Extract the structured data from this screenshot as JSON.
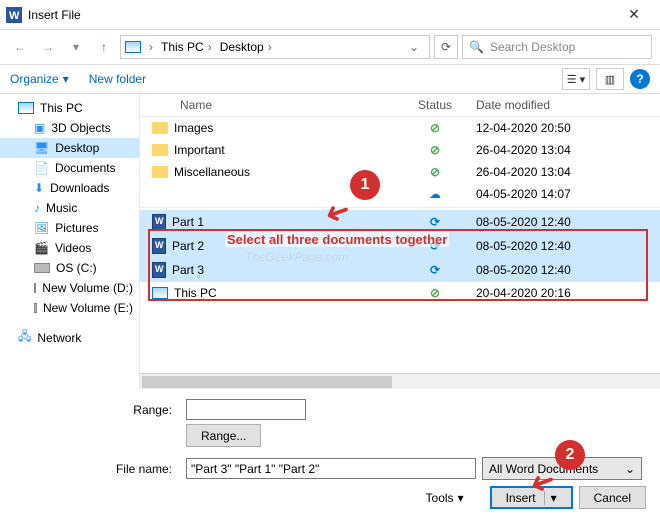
{
  "title": "Insert File",
  "breadcrumb": {
    "root": "",
    "pc": "This PC",
    "loc": "Desktop"
  },
  "search": {
    "placeholder": "Search Desktop"
  },
  "toolbar": {
    "organize": "Organize",
    "newfolder": "New folder"
  },
  "columns": {
    "name": "Name",
    "status": "Status",
    "date": "Date modified"
  },
  "sidebar": {
    "thispc": "This PC",
    "objects3d": "3D Objects",
    "desktop": "Desktop",
    "documents": "Documents",
    "downloads": "Downloads",
    "music": "Music",
    "pictures": "Pictures",
    "videos": "Videos",
    "osc": "OS (C:)",
    "vold": "New Volume (D:)",
    "vole": "New Volume (E:)",
    "network": "Network"
  },
  "files": {
    "images": {
      "name": "Images",
      "status": "ok",
      "date": "12-04-2020 20:50"
    },
    "important": {
      "name": "Important",
      "status": "ok",
      "date": "26-04-2020 13:04"
    },
    "miscellaneous": {
      "name": "Miscellaneous",
      "status": "ok",
      "date": "26-04-2020 13:04"
    },
    "blank": {
      "name": "",
      "status": "cloud",
      "date": "04-05-2020 14:07"
    },
    "part1": {
      "name": "Part 1",
      "status": "sync",
      "date": "08-05-2020 12:40"
    },
    "part2": {
      "name": "Part 2",
      "status": "sync",
      "date": "08-05-2020 12:40"
    },
    "part3": {
      "name": "Part 3",
      "status": "sync",
      "date": "08-05-2020 12:40"
    },
    "thispc": {
      "name": "This PC",
      "status": "ok",
      "date": "20-04-2020 20:16"
    }
  },
  "range": {
    "label": "Range:",
    "button": "Range..."
  },
  "filename": {
    "label": "File name:",
    "value": "\"Part 3\" \"Part 1\" \"Part 2\""
  },
  "filter": "All Word Documents",
  "tools": "Tools",
  "insert": "Insert",
  "cancel": "Cancel",
  "annotation": {
    "text": "Select all three documents together",
    "c1": "1",
    "c2": "2"
  },
  "watermark": "TheGeekPage.com"
}
